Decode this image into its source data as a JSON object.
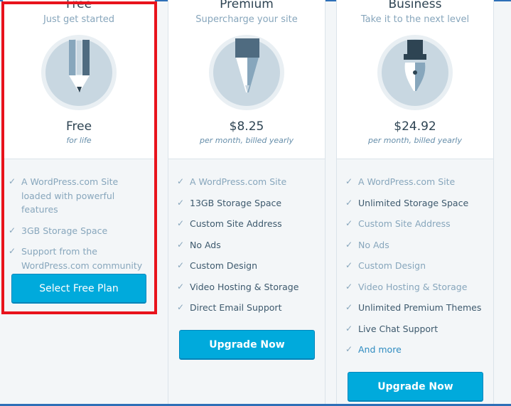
{
  "plans": [
    {
      "name": "Free",
      "tagline": "Just get started",
      "icon": "pencil-icon",
      "price": "Free",
      "price_note": "for life",
      "features": [
        {
          "text": "A WordPress.com Site loaded with powerful features",
          "style": "normal"
        },
        {
          "text": "3GB Storage Space",
          "style": "normal"
        },
        {
          "text": "Support from the WordPress.com community",
          "style": "normal"
        }
      ],
      "button": "Select Free Plan",
      "highlighted": true
    },
    {
      "name": "Premium",
      "tagline": "Supercharge your site",
      "icon": "pen-icon",
      "price": "$8.25",
      "price_note": "per month, billed yearly",
      "features": [
        {
          "text": "A WordPress.com Site",
          "style": "normal"
        },
        {
          "text": "13GB Storage Space",
          "style": "strong"
        },
        {
          "text": "Custom Site Address",
          "style": "strong"
        },
        {
          "text": "No Ads",
          "style": "strong"
        },
        {
          "text": "Custom Design",
          "style": "strong"
        },
        {
          "text": "Video Hosting & Storage",
          "style": "strong"
        },
        {
          "text": "Direct Email Support",
          "style": "strong"
        }
      ],
      "button": "Upgrade Now"
    },
    {
      "name": "Business",
      "tagline": "Take it to the next level",
      "icon": "fountain-pen-icon",
      "price": "$24.92",
      "price_note": "per month, billed yearly",
      "features": [
        {
          "text": "A WordPress.com Site",
          "style": "normal"
        },
        {
          "text": "Unlimited Storage Space",
          "style": "strong"
        },
        {
          "text": "Custom Site Address",
          "style": "normal"
        },
        {
          "text": "No Ads",
          "style": "normal"
        },
        {
          "text": "Custom Design",
          "style": "normal"
        },
        {
          "text": "Video Hosting & Storage",
          "style": "normal"
        },
        {
          "text": "Unlimited Premium Themes",
          "style": "strong"
        },
        {
          "text": "Live Chat Support",
          "style": "strong"
        },
        {
          "text": "And more",
          "style": "link"
        }
      ],
      "button": "Upgrade Now"
    }
  ],
  "colors": {
    "accent": "#00aadc",
    "highlight": "#e8131c",
    "text_dark": "#2e4453",
    "text_muted": "#87a6bc",
    "link": "#2e8bc0"
  }
}
